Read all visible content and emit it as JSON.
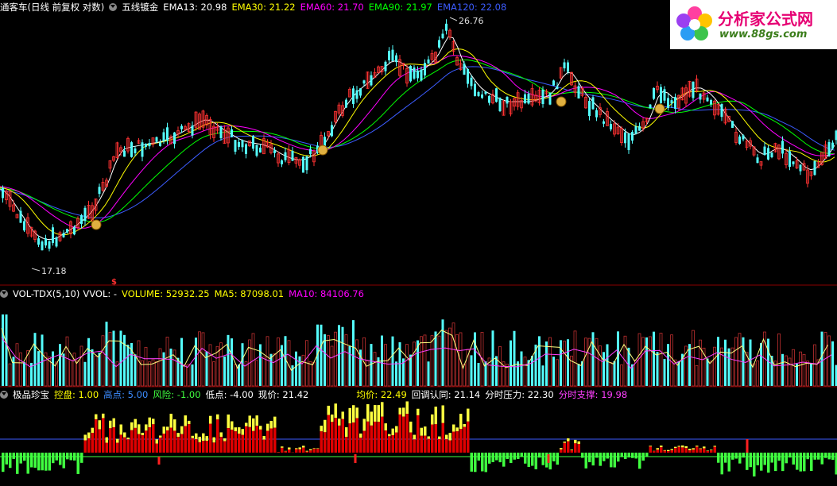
{
  "main_header": {
    "title": "通客车(日线 前复权 对数)",
    "indicator": "五线镀金",
    "ema13": "EMA13: 20.98",
    "ema30": "EMA30: 21.22",
    "ema60": "EMA60: 21.70",
    "ema90": "EMA90: 21.97",
    "ema120": "EMA120: 22.08"
  },
  "price_annotations": {
    "high": "26.76",
    "low": "17.18",
    "signal_mark": "$"
  },
  "vol_header": {
    "name": "VOL-TDX(5,10)",
    "vvol": "VVOL: -",
    "volume": "VOLUME: 52932.25",
    "ma5": "MA5: 87098.01",
    "ma10": "MA10: 84106.76"
  },
  "ind_header": {
    "name": "极品珍宝",
    "kongpan": "控盘: 1.00",
    "gaodian": "高点: 5.00",
    "fengxian": "风险: -1.00",
    "didian": "低点: -4.00",
    "xianjia": "现价: 21.42",
    "junjia": "均价: 22.49",
    "huitiao": "回调认同: 21.14",
    "yali": "分时压力: 22.30",
    "zhicheng": "分时支撑: 19.98"
  },
  "logo": {
    "name": "分析家公式网",
    "url": "www.88gs.com"
  },
  "colors": {
    "up": "#ff3232",
    "down": "#54fcfc",
    "ema13": "#ffffff",
    "ema30": "#ffff00",
    "ema60": "#ff00ff",
    "ema90": "#00ff00",
    "ema120": "#3c5cff",
    "ind_red": "#e00000",
    "ind_yellow": "#ffff40",
    "ind_green": "#40ff40"
  }
}
